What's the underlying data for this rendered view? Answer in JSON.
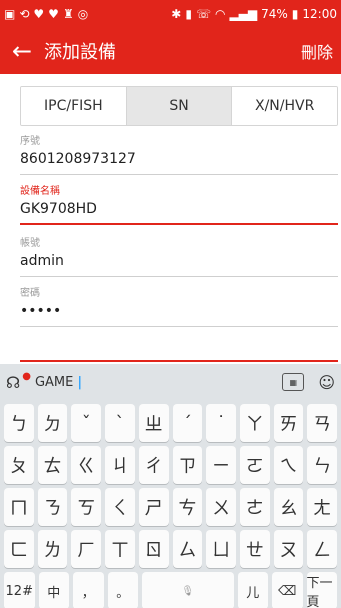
{
  "status_bar": {
    "battery": "74%",
    "time": "12:00"
  },
  "app_bar": {
    "back_label": "←",
    "title": "添加設備",
    "delete_label": "刪除"
  },
  "tabs": [
    {
      "label": "IPC/FISH",
      "active": false
    },
    {
      "label": "SN",
      "active": true
    },
    {
      "label": "X/N/HVR",
      "active": false
    }
  ],
  "fields": {
    "serial": {
      "label": "序號",
      "value": "8601208973127"
    },
    "device_name": {
      "label": "設備名稱",
      "value": "GK9708HD"
    },
    "account": {
      "label": "帳號",
      "value": "admin"
    },
    "password": {
      "label": "密碼",
      "value": "•••••"
    }
  },
  "keyboard": {
    "mode_label": "GAME",
    "rows": [
      [
        "ㄅ",
        "ㄉ",
        "ˇ",
        "ˋ",
        "ㄓ",
        "ˊ",
        "˙",
        "ㄚ",
        "ㄞ",
        "ㄢ"
      ],
      [
        "ㄆ",
        "ㄊ",
        "ㄍ",
        "ㄐ",
        "ㄔ",
        "ㄗ",
        "ㄧ",
        "ㄛ",
        "ㄟ",
        "ㄣ"
      ],
      [
        "ㄇ",
        "ㄋ",
        "ㄎ",
        "ㄑ",
        "ㄕ",
        "ㄘ",
        "ㄨ",
        "ㄜ",
        "ㄠ",
        "ㄤ"
      ],
      [
        "ㄈ",
        "ㄌ",
        "ㄏ",
        "ㄒ",
        "ㄖ",
        "ㄙ",
        "ㄩ",
        "ㄝ",
        "ㄡ",
        "ㄥ"
      ]
    ],
    "bottom": {
      "symbols": "12#",
      "lang": "中",
      "comma": "，",
      "period": "。",
      "space": "",
      "char_er": "儿",
      "backspace": "⌫",
      "next_page": "下一頁"
    }
  }
}
